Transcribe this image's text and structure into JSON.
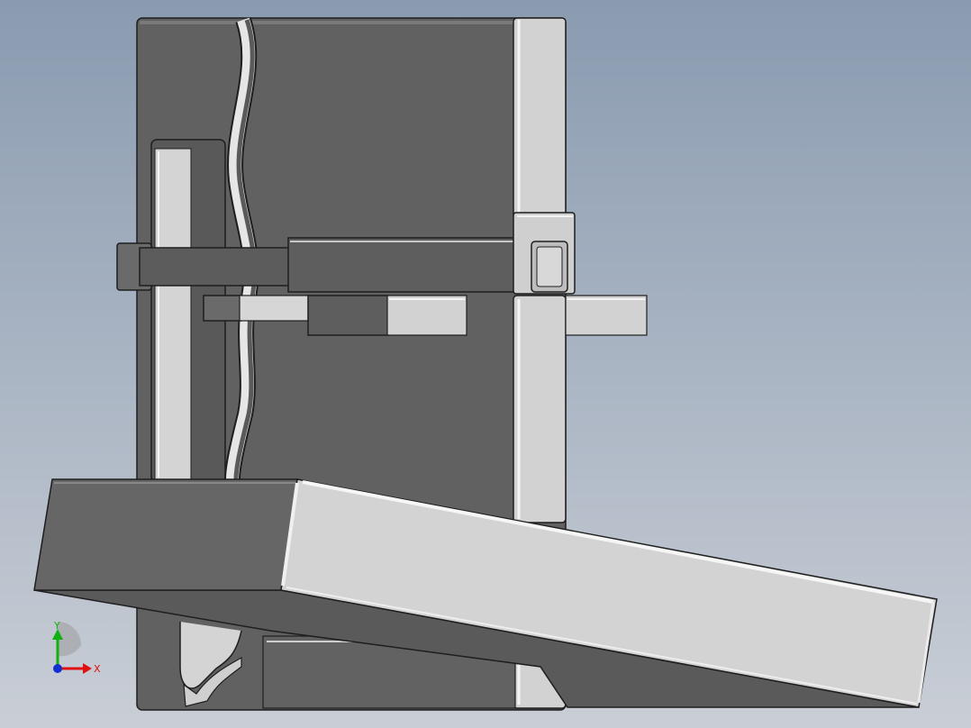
{
  "viewport": {
    "background_top": "#8a9bb0",
    "background_bottom": "#c9ced6"
  },
  "colors": {
    "dark_face": "#646464",
    "darker_face": "#555555",
    "light_face": "#d2d2d2",
    "highlight": "#f2f2f2",
    "edge": "#1e1e1e"
  },
  "triad": {
    "x_label": "X",
    "y_label": "Y",
    "x_color": "#e01010",
    "y_color": "#10b010",
    "z_color": "#1030d0"
  }
}
